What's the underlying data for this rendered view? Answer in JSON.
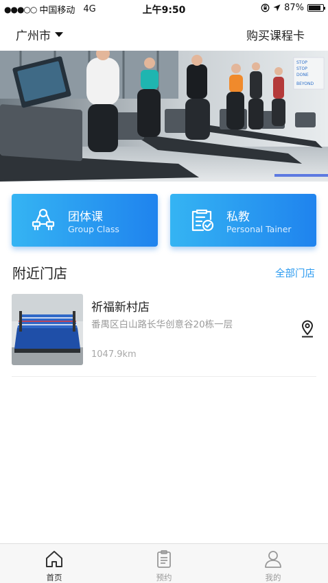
{
  "status_bar": {
    "signal": "●●●○○",
    "carrier": "中国移动",
    "network": "4G",
    "time": "上午9:50",
    "battery": "87%",
    "battery_level": 0.87
  },
  "nav": {
    "city": "广州市",
    "buy_card": "购买课程卡"
  },
  "banner": {
    "sign_lines": [
      "STOP",
      "STOP",
      "DONE",
      "BEYOND"
    ]
  },
  "cards": {
    "group": {
      "title": "团体课",
      "subtitle": "Group Class",
      "icon": "barbell-icon"
    },
    "personal": {
      "title": "私教",
      "subtitle": "Personal Tainer",
      "icon": "clipboard-check-icon"
    }
  },
  "nearby": {
    "title": "附近门店",
    "all_link": "全部门店",
    "stores": [
      {
        "name": "祈福新村店",
        "address": "番禺区白山路长华创意谷20栋一层",
        "distance": "1047.9km",
        "icon": "location-pin-icon"
      }
    ]
  },
  "tabbar": {
    "items": [
      {
        "label": "首页",
        "icon": "home-icon",
        "active": true
      },
      {
        "label": "预约",
        "icon": "clipboard-icon",
        "active": false
      },
      {
        "label": "我的",
        "icon": "user-icon",
        "active": false
      }
    ]
  },
  "colors": {
    "accent": "#2a9af0",
    "card_gradient_start": "#35b4f3",
    "card_gradient_end": "#1f83ee"
  }
}
